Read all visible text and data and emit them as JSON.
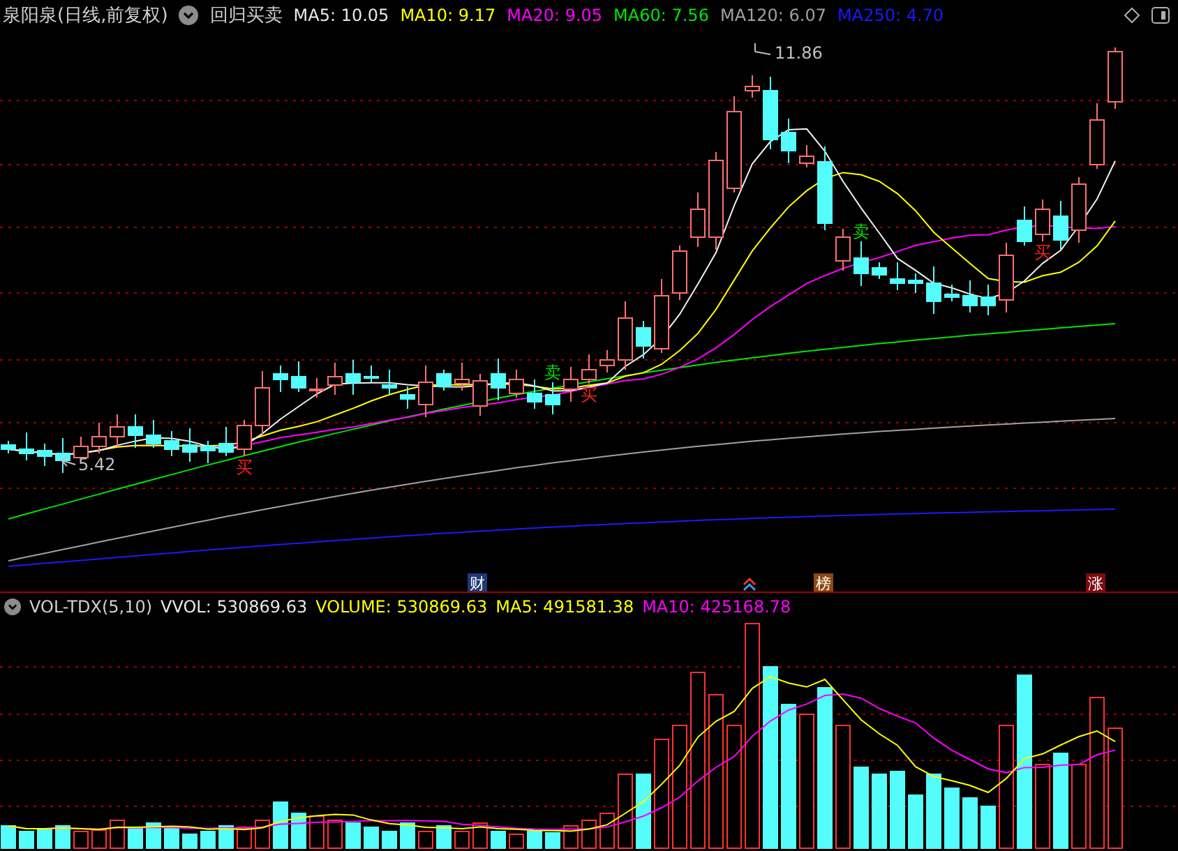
{
  "chart_title": "泉阳泉(日线,前复权)",
  "indicator": "回归买卖",
  "ma_legend": [
    {
      "label": "MA5: 10.05",
      "color": "#e8e8e8"
    },
    {
      "label": "MA10: 9.17",
      "color": "#ffff00"
    },
    {
      "label": "MA20: 9.05",
      "color": "#ff00ff"
    },
    {
      "label": "MA60: 7.56",
      "color": "#00e600"
    },
    {
      "label": "MA120: 6.07",
      "color": "#a0a0a0"
    },
    {
      "label": "MA250: 4.70",
      "color": "#1a1aff"
    }
  ],
  "high_label": "11.86",
  "low_label": "5.42",
  "signals": [
    {
      "kind": "buy",
      "label": "买"
    },
    {
      "kind": "sell",
      "label": "卖"
    },
    {
      "kind": "buy",
      "label": "买"
    },
    {
      "kind": "sell",
      "label": "卖"
    },
    {
      "kind": "buy",
      "label": "买"
    }
  ],
  "event_markers": [
    {
      "kind": "finance",
      "label": "财"
    },
    {
      "kind": "arrow"
    },
    {
      "kind": "rank",
      "label": "榜"
    },
    {
      "kind": "limit",
      "label": "涨"
    }
  ],
  "volume_panel": {
    "name": "VOL-TDX(5,10)",
    "legend": [
      {
        "label": "VVOL: 530869.63",
        "color": "#e8e8e8"
      },
      {
        "label": "VOLUME: 530869.63",
        "color": "#ffff00"
      },
      {
        "label": "MA5: 491581.38",
        "color": "#ffff00"
      },
      {
        "label": "MA10: 425168.78",
        "color": "#ff00ff"
      }
    ]
  }
}
